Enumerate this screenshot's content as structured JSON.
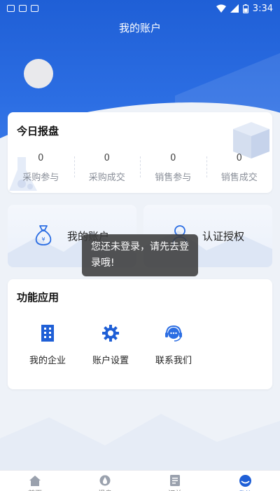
{
  "status_bar": {
    "time": "3:34"
  },
  "header": {
    "title": "我的账户"
  },
  "today": {
    "title": "今日报盘",
    "stats": [
      {
        "value": "0",
        "label": "采购参与"
      },
      {
        "value": "0",
        "label": "采购成交"
      },
      {
        "value": "0",
        "label": "销售参与"
      },
      {
        "value": "0",
        "label": "销售成交"
      }
    ]
  },
  "quick": {
    "account_label": "我的账户",
    "auth_label": "认证授权"
  },
  "toast": {
    "message": "您还未登录，请先去登录哦!"
  },
  "functions": {
    "title": "功能应用",
    "items": [
      {
        "label": "我的企业",
        "icon": "building-icon"
      },
      {
        "label": "账户设置",
        "icon": "gear-icon"
      },
      {
        "label": "联系我们",
        "icon": "headset-icon"
      }
    ]
  },
  "nav": {
    "items": [
      {
        "label": "首页",
        "icon": "home-icon"
      },
      {
        "label": "报盘",
        "icon": "drop-icon"
      },
      {
        "label": "订单",
        "icon": "document-icon"
      },
      {
        "label": "我的",
        "icon": "user-icon"
      }
    ],
    "active_index": 3
  },
  "colors": {
    "primary": "#1f5fd6",
    "background": "#eef2f8"
  }
}
